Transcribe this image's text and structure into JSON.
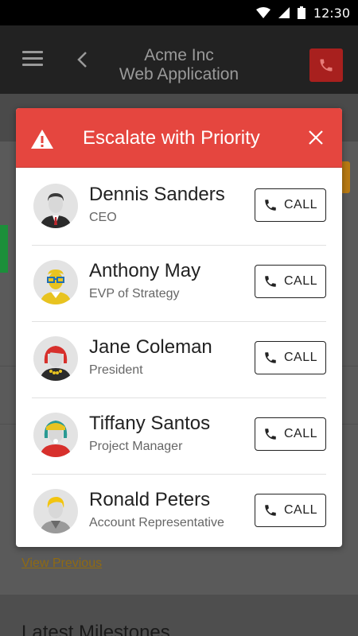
{
  "status_bar": {
    "time": "12:30",
    "icons": [
      "wifi-icon",
      "signal-icon",
      "battery-icon"
    ]
  },
  "app_bar": {
    "title_line1": "Acme Inc",
    "title_line2": "Web Application"
  },
  "background": {
    "view_previous": "View Previous",
    "latest_milestones": "Latest Milestones"
  },
  "modal": {
    "title": "Escalate with Priority",
    "header_color": "#e5463f",
    "contacts": [
      {
        "name": "Dennis Sanders",
        "role": "CEO",
        "call_label": "CALL"
      },
      {
        "name": "Anthony May",
        "role": "EVP of Strategy",
        "call_label": "CALL"
      },
      {
        "name": "Jane Coleman",
        "role": "President",
        "call_label": "CALL"
      },
      {
        "name": "Tiffany Santos",
        "role": "Project Manager",
        "call_label": "CALL"
      },
      {
        "name": "Ronald Peters",
        "role": "Account Representative",
        "call_label": "CALL"
      }
    ]
  }
}
